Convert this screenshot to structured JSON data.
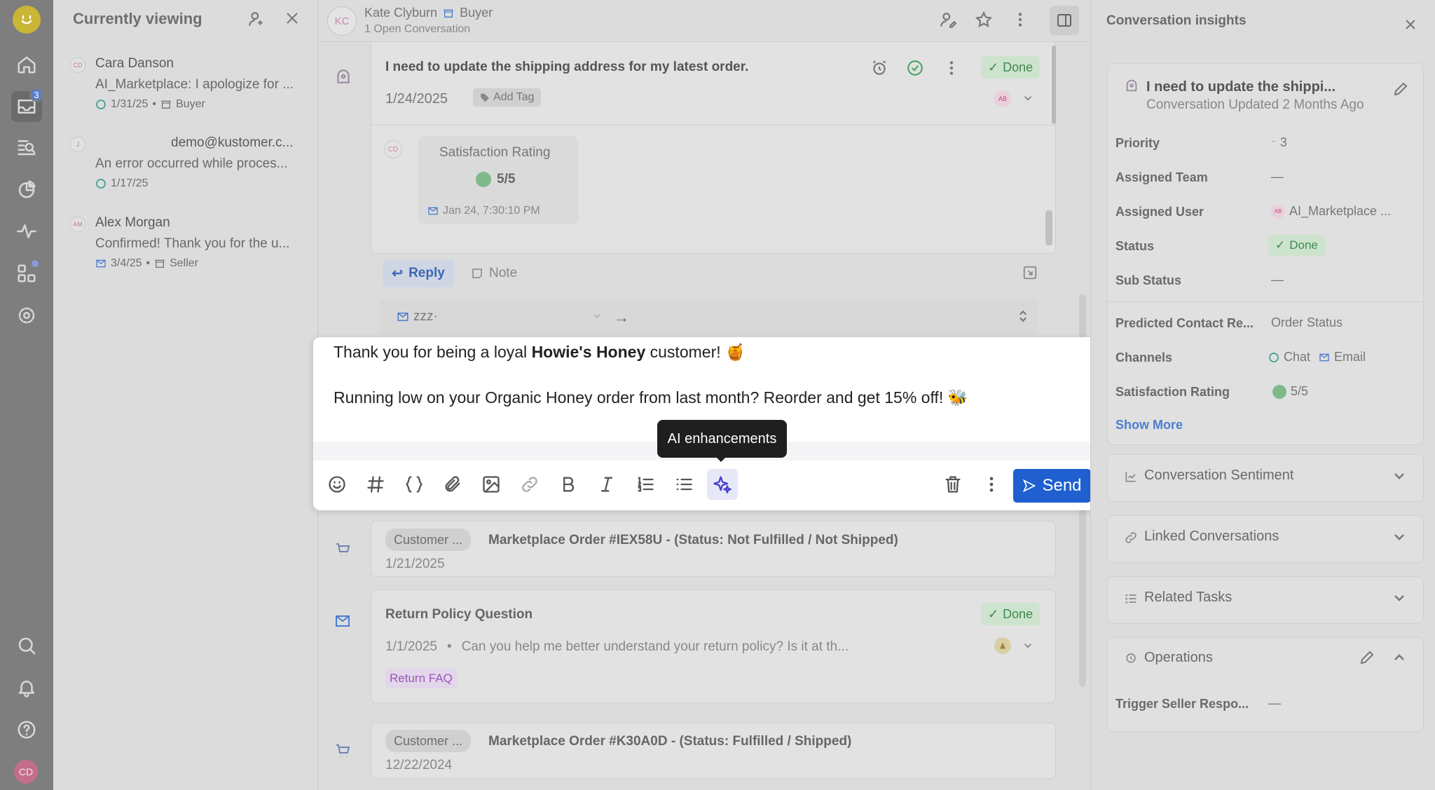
{
  "rail": {
    "inbox_badge": "3",
    "user_initials": "CD",
    "icons": [
      "home-icon",
      "inbox-icon",
      "search-list-icon",
      "reporting-icon",
      "activity-icon",
      "apps-icon",
      "settings-icon",
      "search-icon",
      "bell-icon",
      "help-icon"
    ]
  },
  "currently_viewing": {
    "title": "Currently viewing",
    "items": [
      {
        "initials": "CD",
        "name": "Cara Danson",
        "message": "AI_Marketplace: I apologize for ...",
        "date": "1/31/25",
        "role": "Buyer"
      },
      {
        "initials": "J",
        "name": "demo@kustomer.c...",
        "message": "An error occurred while proces...",
        "date": "1/17/25",
        "role": ""
      },
      {
        "initials": "AM",
        "name": "Alex Morgan",
        "message": "Confirmed! Thank you for the u...",
        "date": "3/4/25",
        "role": "Seller"
      }
    ]
  },
  "header": {
    "initials": "KC",
    "customer_name": "Kate Clyburn",
    "customer_role": "Buyer",
    "open_conversations": "1 Open Conversation"
  },
  "conversation": {
    "subject": "I need to update the shipping address for my latest order.",
    "date": "1/24/2025",
    "add_tag": "Add Tag",
    "status": "Done",
    "assignee_initials": "AB",
    "satisfaction": {
      "initials": "CD",
      "title": "Satisfaction Rating",
      "score": "5/5",
      "timestamp": "Jan 24, 7:30:10 PM"
    },
    "reply_tab": "Reply",
    "note_tab": "Note",
    "from_address": "zzz·"
  },
  "composer": {
    "line1_prefix": "Thank you for being a loyal ",
    "line1_bold": "Howie's Honey",
    "line1_suffix": " customer! 🍯",
    "line2": "Running low on your Organic Honey order from last month? Reorder and get 15% off! 🐝",
    "tooltip": "AI enhancements",
    "send_label": "Send"
  },
  "timeline": [
    {
      "type": "order",
      "chip": "Customer ...",
      "title": "Marketplace Order #IEX58U - (Status: Not Fulfilled / Not Shipped)",
      "date": "1/21/2025"
    },
    {
      "type": "email",
      "title": "Return Policy Question",
      "status": "Done",
      "date": "1/1/2025",
      "bullet": "•",
      "preview": "Can you help me better understand your return policy? Is it at th...",
      "tag": "Return FAQ"
    },
    {
      "type": "order",
      "chip": "Customer ...",
      "title": "Marketplace Order #K30A0D - (Status: Fulfilled / Shipped)",
      "date": "12/22/2024"
    }
  ],
  "insights": {
    "title": "Conversation insights",
    "conv_title": "I need to update the shippi...",
    "conv_updated": "Conversation Updated 2 Months Ago",
    "fields": [
      {
        "label": "Priority",
        "value": "3"
      },
      {
        "label": "Assigned Team",
        "value": "—"
      },
      {
        "label": "Assigned User",
        "value": "AI_Marketplace ..."
      },
      {
        "label": "Status",
        "value": "Done"
      },
      {
        "label": "Sub Status",
        "value": "—"
      },
      {
        "label": "Predicted Contact Re...",
        "value": "Order Status"
      },
      {
        "label": "Channels",
        "value": "Chat"
      },
      {
        "label": "Satisfaction Rating",
        "value": "5/5"
      }
    ],
    "assigned_user_initials": "AB",
    "channel_email": "Email",
    "show_more": "Show More",
    "sections": [
      "Conversation Sentiment",
      "Linked Conversations",
      "Related Tasks",
      "Operations"
    ],
    "operations_field": {
      "label": "Trigger Seller Respo...",
      "value": "—"
    }
  }
}
